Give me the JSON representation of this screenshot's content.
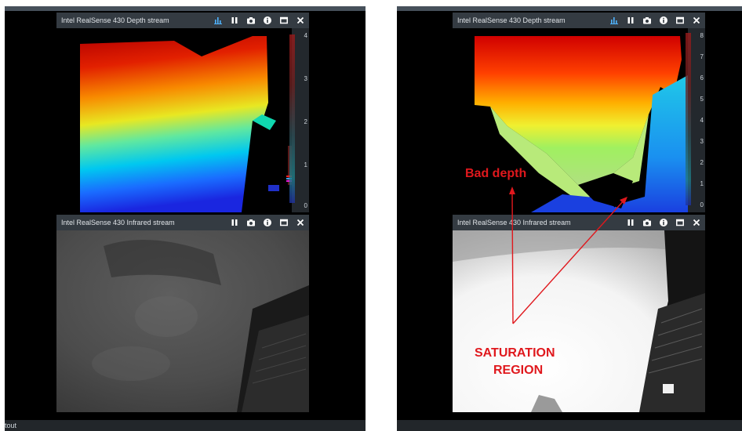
{
  "depth_window": {
    "title": "Intel RealSense 430 Depth stream",
    "icons": [
      "histogram-icon",
      "pause-icon",
      "camera-icon",
      "info-icon",
      "maximize-icon",
      "close-icon"
    ]
  },
  "infrared_window": {
    "title": "Intel RealSense 430 Infrared stream",
    "icons": [
      "pause-icon",
      "camera-icon",
      "info-icon",
      "maximize-icon",
      "close-icon"
    ]
  },
  "left": {
    "depth_scale": [
      "4",
      "3",
      "2",
      "1",
      "0"
    ]
  },
  "right": {
    "depth_scale": [
      "8",
      "7",
      "6",
      "5",
      "4",
      "3",
      "2",
      "1",
      "0"
    ]
  },
  "status": {
    "text": "tout"
  },
  "annotations": {
    "bad_depth": "Bad depth",
    "saturation_line1": "SATURATION",
    "saturation_line2": "REGION",
    "color": "#e0181d"
  }
}
